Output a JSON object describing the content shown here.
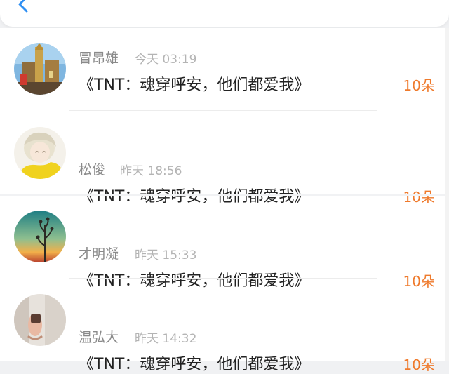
{
  "header": {
    "back_icon": "chevron-left-icon",
    "accent": "#2f8ff3"
  },
  "colors": {
    "amount": "#ef7a2c",
    "name": "#8a8a8a",
    "time": "#b4b4b4",
    "title": "#222222"
  },
  "items": [
    {
      "name": "冒昂雄",
      "time": "今天 03:19",
      "title": "《TNT：魂穿呼安，他们都爱我》",
      "amount": "10朵",
      "avatar": "cathedral-photo-avatar"
    },
    {
      "name": "松俊",
      "time": "昨天 18:56",
      "title": "《TNT：魂穿呼安，他们都爱我》",
      "amount": "10朵",
      "avatar": "anime-boy-avatar"
    },
    {
      "name": "才明凝",
      "time": "昨天 15:33",
      "title": "《TNT：魂穿呼安，他们都爱我》",
      "amount": "10朵",
      "avatar": "sunset-plant-avatar"
    },
    {
      "name": "温弘大",
      "time": "昨天 14:32",
      "title": "《TNT：魂穿呼安，他们都爱我》",
      "amount": "10朵",
      "avatar": "hand-mirror-avatar"
    }
  ]
}
